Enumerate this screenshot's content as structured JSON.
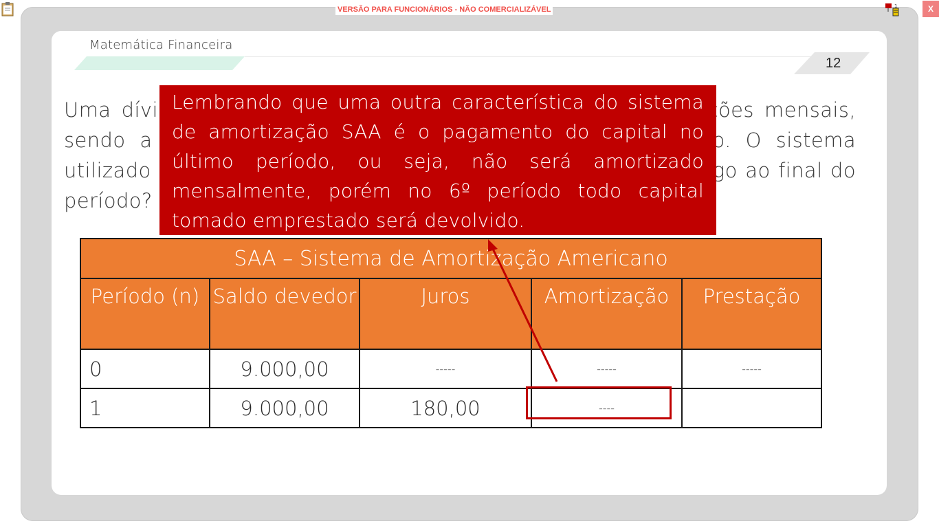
{
  "banner": "VERSÃO PARA FUNCIONÁRIOS - NÃO COMERCIALIZÁVEL",
  "close_label": "X",
  "header": {
    "title": "Matemática Financeira",
    "page_number": "12"
  },
  "paragraph": "Uma dívida de R$ 9.000,00 será amortizada em seis prestações mensais, sendo a primeira no final do primeiro mês do empréstimo. O sistema utilizado foi o SAA, com juros de 2% a.m. Qual o montante pago ao final do período?",
  "callout": "Lembrando que uma outra característica do sistema de amortização SAA é o pagamento do capital no último período, ou seja, não será amortizado mensalmente, porém no 6º período todo capital tomado emprestado será devolvido.",
  "table": {
    "title": "SAA – Sistema de Amortização Americano",
    "headers": [
      "Período (n)",
      "Saldo devedor",
      "Juros",
      "Amortização",
      "Prestação"
    ],
    "rows": [
      [
        "0",
        "9.000,00",
        "-----",
        "-----",
        "-----"
      ],
      [
        "1",
        "9.000,00",
        "180,00",
        "----",
        ""
      ]
    ]
  },
  "icons": {
    "clipboard": "clipboard-icon",
    "network": "network-icon"
  },
  "colors": {
    "accent": "#ed7d31",
    "callout": "#c00000",
    "banner": "#f0504a"
  }
}
